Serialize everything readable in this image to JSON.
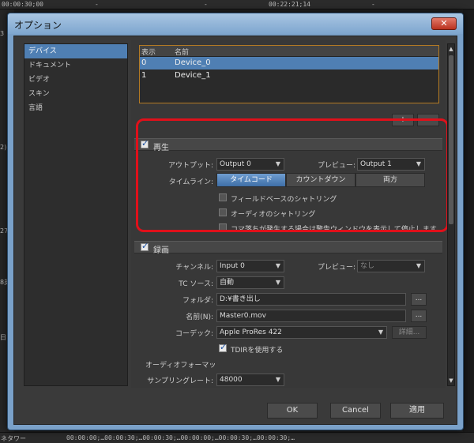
{
  "background": {
    "timecodes": [
      "00:00:30;00",
      "-",
      "-",
      "00:22:21;14",
      "-"
    ],
    "left_labels": [
      "3",
      "2)",
      "27F",
      "8",
      "8英",
      "日"
    ],
    "bottom_left": "ネタワー",
    "bottom_timeline": "00:00:00;…00:00:30;…00:00:30;…00:00:00;…00:00:30;…00:00:30;…"
  },
  "dialog": {
    "title": "オプション",
    "close_icon": "✕",
    "sidebar": [
      {
        "label": "デバイス",
        "selected": true
      },
      {
        "label": "ドキュメント",
        "selected": false
      },
      {
        "label": "ビデオ",
        "selected": false
      },
      {
        "label": "スキン",
        "selected": false
      },
      {
        "label": "言語",
        "selected": false
      }
    ],
    "devices": {
      "columns": [
        "表示",
        "名前"
      ],
      "rows": [
        {
          "index": "0",
          "name": "Device_0",
          "selected": true
        },
        {
          "index": "1",
          "name": "Device_1",
          "selected": false
        }
      ],
      "add_label": "+",
      "remove_label": "-"
    },
    "playback": {
      "title": "再生",
      "enabled": true,
      "output_label": "アウトプット:",
      "output_value": "Output 0",
      "preview_label": "プレビュー:",
      "preview_value": "Output 1",
      "timeline_label": "タイムライン:",
      "timeline_options": [
        "タイムコード",
        "カウントダウン",
        "両方"
      ],
      "timeline_selected": 0,
      "options": [
        {
          "label": "フィールドベースのシャトリング",
          "checked": false
        },
        {
          "label": "オーディオのシャトリング",
          "checked": false
        },
        {
          "label": "コマ落ちが発生する場合は警告ウィンドウを表示して停止します",
          "checked": false
        }
      ]
    },
    "record": {
      "title": "録画",
      "enabled": true,
      "channel_label": "チャンネル:",
      "channel_value": "Input 0",
      "preview_label": "プレビュー:",
      "preview_value": "なし",
      "tc_label": "TC ソース:",
      "tc_value": "自動",
      "folder_label": "フォルダ:",
      "folder_value": "D:¥書き出し",
      "name_label": "名前(N):",
      "name_value": "Master0.mov",
      "codec_label": "コーデック:",
      "codec_value": "Apple ProRes 422",
      "detail_label": "詳細...",
      "browse_label": "...",
      "tdir_label": "TDIRを使用する",
      "tdir_checked": true,
      "audio_format_label": "オーディオフォーマッ",
      "sample_rate_label": "サンプリングレート:",
      "sample_rate_value": "48000"
    },
    "buttons": {
      "ok": "OK",
      "cancel": "Cancel",
      "apply": "適用"
    },
    "combo_arrow": "▼",
    "scroll_up": "▲",
    "scroll_down": "▼"
  },
  "colors": {
    "selection": "#4f7fb3",
    "highlight": "#e0101a",
    "titlebar": "#7ea6cf"
  }
}
